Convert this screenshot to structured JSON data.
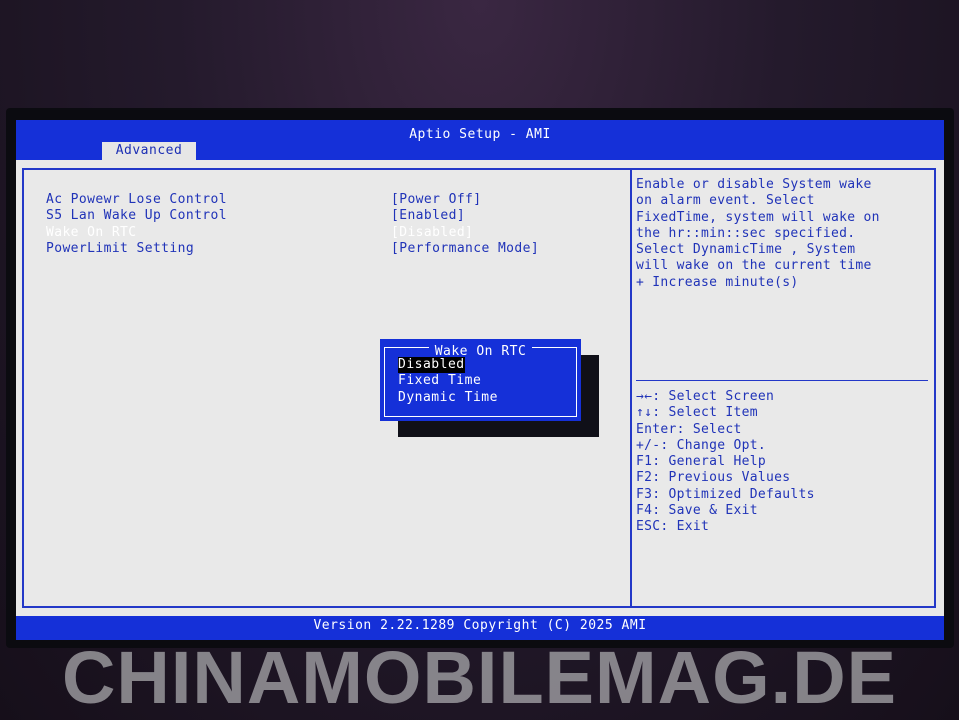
{
  "app": {
    "title": "Aptio Setup - AMI"
  },
  "tabs": [
    {
      "label": "Advanced"
    }
  ],
  "settings": [
    {
      "label": "Ac Powewr Lose Control",
      "value": "[Power Off]"
    },
    {
      "label": "S5 Lan Wake Up Control",
      "value": "[Enabled]"
    },
    {
      "label": "Wake On RTC",
      "value": "[Disabled]"
    },
    {
      "label": "PowerLimit Setting",
      "value": "[Performance Mode]"
    }
  ],
  "help_text": "Enable or disable System wake\non alarm event. Select\nFixedTime, system will wake on\nthe hr::min::sec specified.\nSelect DynamicTime , System\nwill wake on the current time\n+ Increase minute(s)",
  "keys": [
    "→←: Select Screen",
    "↑↓: Select Item",
    "Enter: Select",
    "+/-: Change Opt.",
    "F1: General Help",
    "F2: Previous Values",
    "F3: Optimized Defaults",
    "F4: Save & Exit",
    "ESC: Exit"
  ],
  "popup": {
    "title": "Wake On RTC",
    "options": [
      "Disabled",
      "Fixed Time",
      "Dynamic Time"
    ],
    "selected": "Disabled"
  },
  "footer": {
    "version": "Version 2.22.1289 Copyright (C) 2025 AMI"
  },
  "watermark": "CHINAMOBILEMAG.DE",
  "colors": {
    "bios_blue": "#1530d8",
    "bios_gray": "#e9e9e9",
    "text_blue": "#2033b8"
  }
}
